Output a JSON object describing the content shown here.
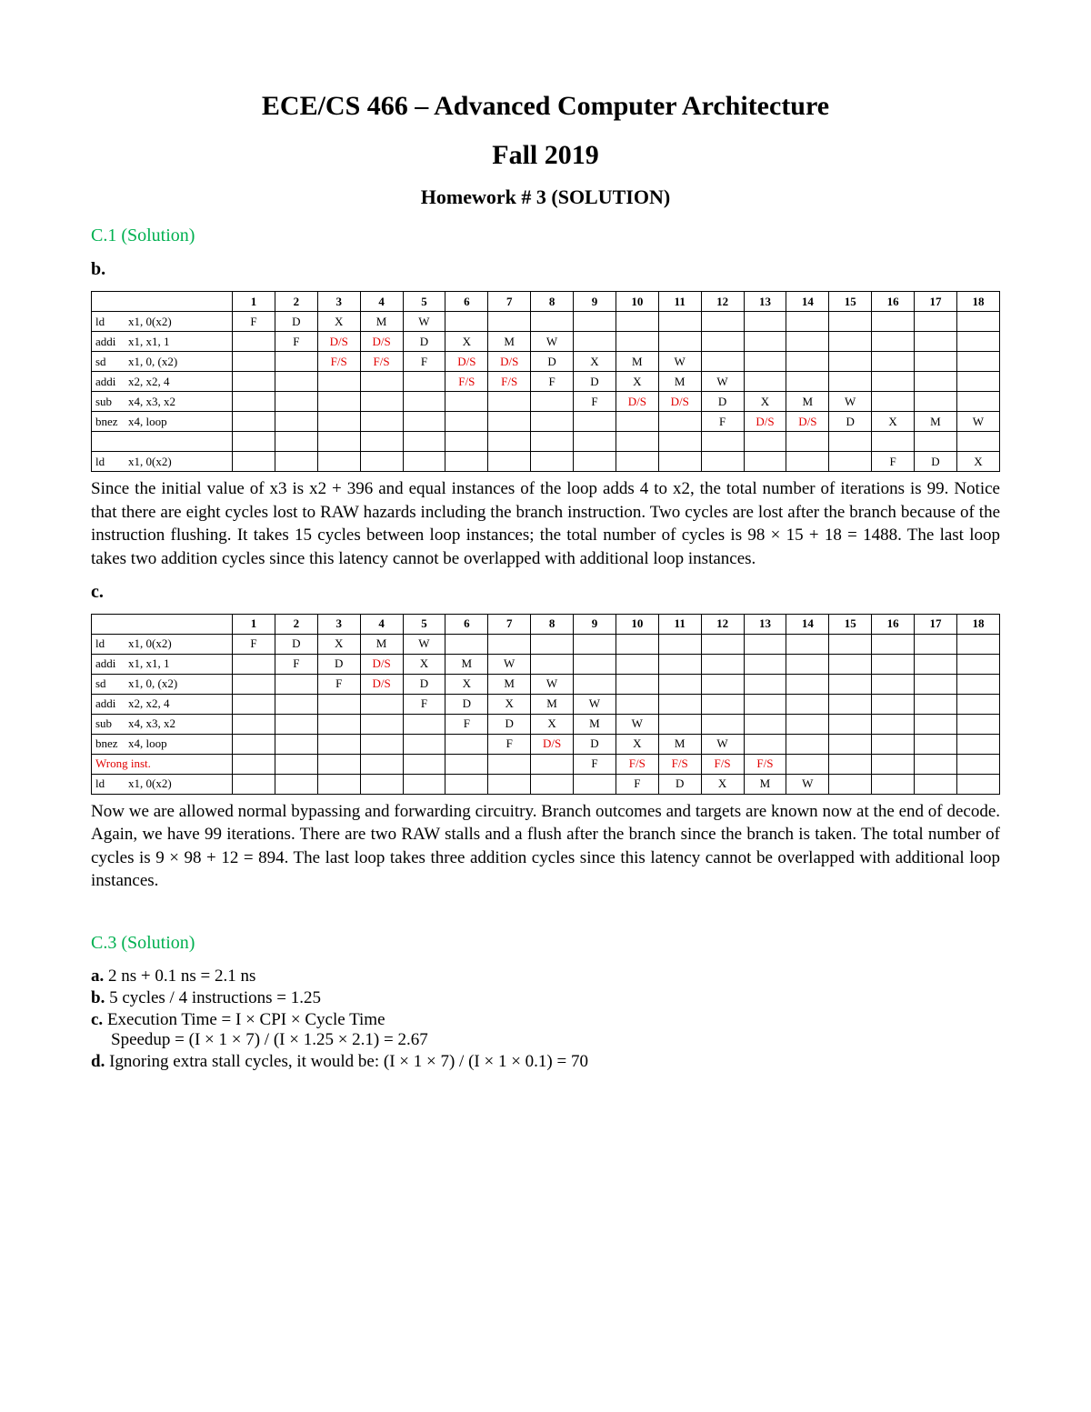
{
  "header": {
    "title": "ECE/CS 466 – Advanced Computer Architecture",
    "term": "Fall 2019",
    "homework": "Homework # 3 (SOLUTION)"
  },
  "c1": {
    "heading": "C.1 (Solution)",
    "part_b": "b.",
    "part_c": "c.",
    "cycles": [
      "1",
      "2",
      "3",
      "4",
      "5",
      "6",
      "7",
      "8",
      "9",
      "10",
      "11",
      "12",
      "13",
      "14",
      "15",
      "16",
      "17",
      "18"
    ],
    "table_b": {
      "rows": [
        {
          "instr_op": "ld",
          "instr_args": "x1, 0(x2)",
          "cells": [
            "F",
            "D",
            "X",
            "M",
            "W",
            "",
            "",
            "",
            "",
            "",
            "",
            "",
            "",
            "",
            "",
            "",
            "",
            ""
          ]
        },
        {
          "instr_op": "addi",
          "instr_args": "x1, x1, 1",
          "cells": [
            "",
            "F",
            "D/S",
            "D/S",
            "D",
            "X",
            "M",
            "W",
            "",
            "",
            "",
            "",
            "",
            "",
            "",
            "",
            "",
            ""
          ]
        },
        {
          "instr_op": "sd",
          "instr_args": "x1, 0, (x2)",
          "cells": [
            "",
            "",
            "F/S",
            "F/S",
            "F",
            "D/S",
            "D/S",
            "D",
            "X",
            "M",
            "W",
            "",
            "",
            "",
            "",
            "",
            "",
            ""
          ]
        },
        {
          "instr_op": "addi",
          "instr_args": "x2, x2, 4",
          "cells": [
            "",
            "",
            "",
            "",
            "",
            "F/S",
            "F/S",
            "F",
            "D",
            "X",
            "M",
            "W",
            "",
            "",
            "",
            "",
            "",
            ""
          ]
        },
        {
          "instr_op": "sub",
          "instr_args": "x4, x3, x2",
          "cells": [
            "",
            "",
            "",
            "",
            "",
            "",
            "",
            "",
            "F",
            "D/S",
            "D/S",
            "D",
            "X",
            "M",
            "W",
            "",
            "",
            ""
          ]
        },
        {
          "instr_op": "bnez",
          "instr_args": "x4, loop",
          "cells": [
            "",
            "",
            "",
            "",
            "",
            "",
            "",
            "",
            "",
            "",
            "",
            "F",
            "D/S",
            "D/S",
            "D",
            "X",
            "M",
            "W"
          ]
        },
        {
          "instr_op": "",
          "instr_args": "",
          "cells": [
            "",
            "",
            "",
            "",
            "",
            "",
            "",
            "",
            "",
            "",
            "",
            "",
            "",
            "",
            "",
            "",
            "",
            ""
          ]
        },
        {
          "instr_op": "ld",
          "instr_args": "x1, 0(x2)",
          "cells": [
            "",
            "",
            "",
            "",
            "",
            "",
            "",
            "",
            "",
            "",
            "",
            "",
            "",
            "",
            "",
            "F",
            "D",
            "X"
          ]
        }
      ],
      "stall_markers": [
        "D/S",
        "F/S"
      ]
    },
    "explain_b": "Since the initial value of x3 is x2 + 396 and equal instances of the loop adds 4 to x2, the total number of iterations is 99. Notice that there are eight cycles lost to RAW hazards including the branch instruction. Two cycles are lost after the branch because of the instruction flushing. It takes 15 cycles between loop instances; the total number of cycles is 98 × 15 + 18 = 1488. The last loop takes two addition cycles since this latency cannot be overlapped with additional loop instances.",
    "table_c": {
      "rows": [
        {
          "instr_op": "ld",
          "instr_args": "x1, 0(x2)",
          "cells": [
            "F",
            "D",
            "X",
            "M",
            "W",
            "",
            "",
            "",
            "",
            "",
            "",
            "",
            "",
            "",
            "",
            "",
            "",
            ""
          ]
        },
        {
          "instr_op": "addi",
          "instr_args": "x1, x1, 1",
          "cells": [
            "",
            "F",
            "D",
            "D/S",
            "X",
            "M",
            "W",
            "",
            "",
            "",
            "",
            "",
            "",
            "",
            "",
            "",
            "",
            ""
          ]
        },
        {
          "instr_op": "sd",
          "instr_args": "x1, 0, (x2)",
          "cells": [
            "",
            "",
            "F",
            "D/S",
            "D",
            "X",
            "M",
            "W",
            "",
            "",
            "",
            "",
            "",
            "",
            "",
            "",
            "",
            ""
          ]
        },
        {
          "instr_op": "addi",
          "instr_args": "x2, x2, 4",
          "cells": [
            "",
            "",
            "",
            "",
            "F",
            "D",
            "X",
            "M",
            "W",
            "",
            "",
            "",
            "",
            "",
            "",
            "",
            "",
            ""
          ]
        },
        {
          "instr_op": "sub",
          "instr_args": "x4, x3, x2",
          "cells": [
            "",
            "",
            "",
            "",
            "",
            "F",
            "D",
            "X",
            "M",
            "W",
            "",
            "",
            "",
            "",
            "",
            "",
            "",
            ""
          ]
        },
        {
          "instr_op": "bnez",
          "instr_args": "x4, loop",
          "cells": [
            "",
            "",
            "",
            "",
            "",
            "",
            "F",
            "D/S",
            "D",
            "X",
            "M",
            "W",
            "",
            "",
            "",
            "",
            "",
            ""
          ]
        },
        {
          "instr_op": "Wrong inst.",
          "instr_args": "",
          "cells": [
            "",
            "",
            "",
            "",
            "",
            "",
            "",
            "",
            "F",
            "F/S",
            "F/S",
            "F/S",
            "F/S",
            "",
            "",
            "",
            "",
            ""
          ],
          "wrong": true
        },
        {
          "instr_op": "ld",
          "instr_args": "x1, 0(x2)",
          "cells": [
            "",
            "",
            "",
            "",
            "",
            "",
            "",
            "",
            "",
            "F",
            "D",
            "X",
            "M",
            "W",
            "",
            "",
            "",
            ""
          ]
        }
      ],
      "stall_markers": [
        "D/S",
        "F/S"
      ]
    },
    "explain_c": "Now we are allowed normal bypassing and forwarding circuitry. Branch outcomes and targets are known now at the end of decode. Again, we have 99 iterations. There are two RAW stalls and a flush after the branch since the branch is taken. The total number of cycles is 9 × 98 + 12 = 894. The last loop takes three addition cycles since this latency cannot be overlapped with additional loop instances."
  },
  "c3": {
    "heading": "C.3 (Solution)",
    "items": [
      {
        "label": "a.",
        "text": "2 ns + 0.1 ns = 2.1 ns"
      },
      {
        "label": "b.",
        "text": "5 cycles / 4 instructions = 1.25"
      },
      {
        "label": "c.",
        "text": "Execution Time = I × CPI × Cycle Time",
        "extra": "Speedup = (I × 1 × 7) / (I × 1.25 × 2.1) = 2.67"
      },
      {
        "label": "d.",
        "text": "Ignoring extra stall cycles, it would be: (I × 1 × 7) / (I × 1 × 0.1) = 70"
      }
    ]
  }
}
